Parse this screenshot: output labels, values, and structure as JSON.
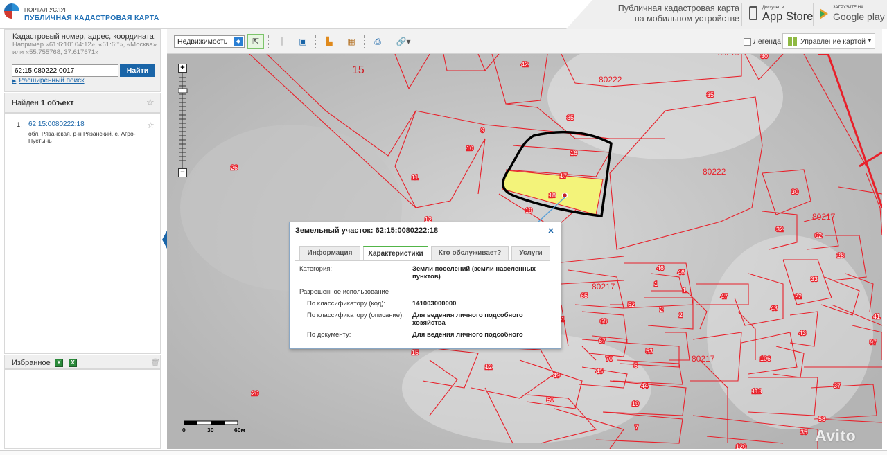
{
  "header": {
    "brand_line1": "ПОРТАЛ УСЛУГ",
    "brand_line2": "ПУБЛИЧНАЯ КАДАСТРОВАЯ КАРТА",
    "mobile_line1": "Публичная кадастровая карта",
    "mobile_line2": "на мобильном устройстве",
    "appstore_small": "Доступно в",
    "appstore_big": "App Store",
    "gplay_small": "ЗАГРУЗИТЕ НА",
    "gplay_big": "Google play"
  },
  "search": {
    "title": "Кадастровый номер, адрес, координата:",
    "hint": "Например «61:6:10104:12», «61:6:*», «Москва» или «55.755768, 37.617671»",
    "value": "62:15:080222:0017",
    "button": "Найти",
    "advanced": "Расширенный поиск"
  },
  "results": {
    "found_prefix": "Найден",
    "found_count": "1 объект",
    "items": [
      {
        "num": "1.",
        "link": "62:15:0080222:18",
        "address": "обл. Рязанская, р-н Рязанский, с. Агро-Пустынь"
      }
    ]
  },
  "favorites": {
    "title": "Избранное"
  },
  "toolbar": {
    "layer": "Недвижимость",
    "legend": "Легенда",
    "map_control": "Управление картой"
  },
  "popup": {
    "title": "Земельный участок: 62:15:0080222:18",
    "tabs": [
      "Информация",
      "Характеристики",
      "Кто обслуживает?",
      "Услуги"
    ],
    "active_tab": "Характеристики",
    "rows": [
      {
        "label": "Категория:",
        "value": "Земли поселений (земли населенных пунктов)"
      },
      {
        "label": "Разрешенное использование",
        "value": ""
      },
      {
        "label": "По классификатору (код):",
        "value": "141003000000"
      },
      {
        "label": "По классификатору (описание):",
        "value": "Для ведения личного подсобного хозяйства"
      },
      {
        "label": "По документу:",
        "value": "Для ведения личного подсобного"
      }
    ]
  },
  "map": {
    "scale_labels": [
      "0",
      "30",
      "60м"
    ],
    "parcel_labels": [
      "15",
      "80222",
      "42",
      "35",
      "80219",
      "30",
      "35",
      "9",
      "10",
      "16",
      "17",
      "18",
      "19",
      "11",
      "26",
      "80222",
      "30",
      "80217",
      "32",
      "62",
      "28",
      "33",
      "46",
      "46",
      "1",
      "1",
      "80217",
      "65",
      "52",
      "2",
      "2",
      "47",
      "43",
      "22",
      "62",
      "61",
      "41",
      "63",
      "68",
      "66",
      "70",
      "53",
      "55",
      "80217",
      "106",
      "224",
      "50",
      "5",
      "44",
      "15",
      "12",
      "49",
      "50",
      "113",
      "37",
      "26",
      "19",
      "7",
      "58",
      "35",
      "120",
      "43",
      "97"
    ],
    "watermark": "Avito",
    "colors": {
      "parcel_line": "#e8202a",
      "highlight": "#f3f37a",
      "outline": "#000000",
      "accent": "#1a65a8"
    }
  }
}
